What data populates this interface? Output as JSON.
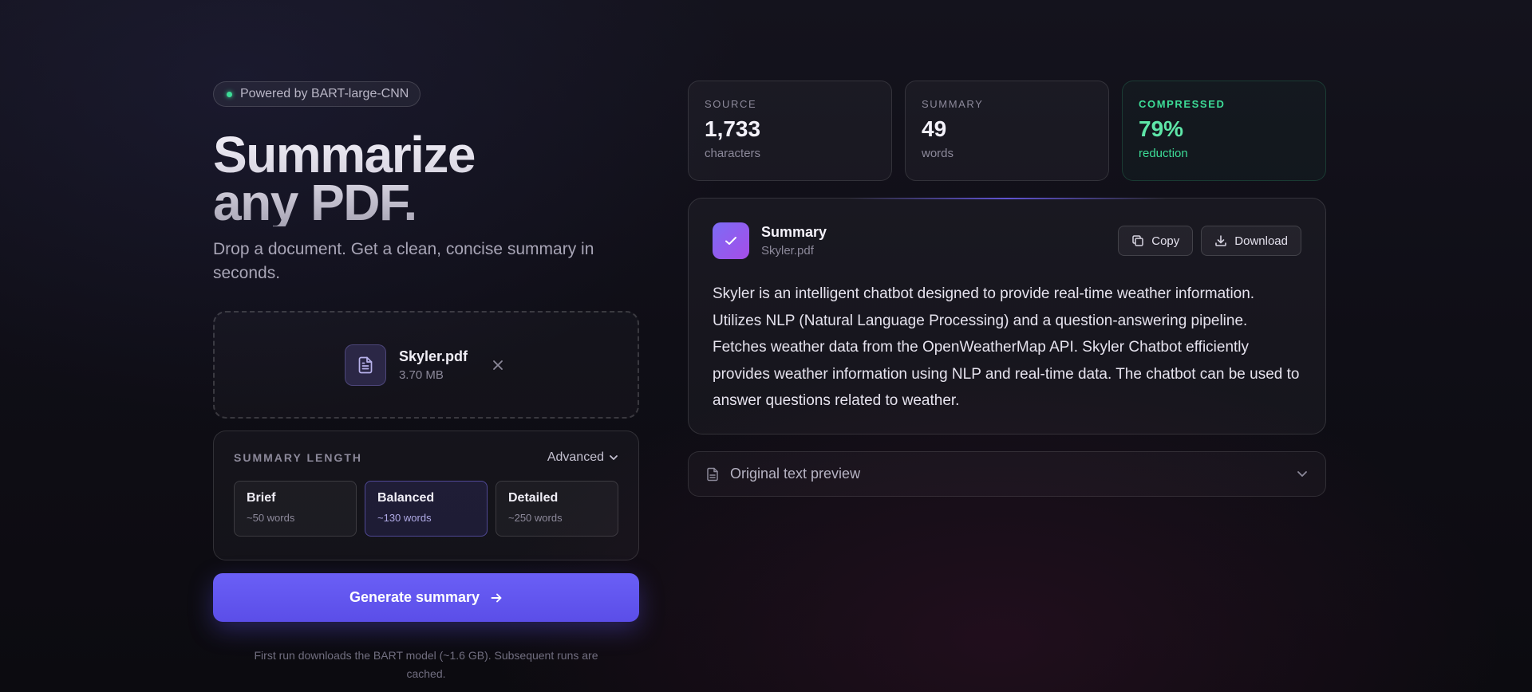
{
  "badge": {
    "text": "Powered by BART-large-CNN"
  },
  "hero": {
    "title_line1": "Summarize",
    "title_line2": "any PDF.",
    "subtitle": "Drop a document. Get a clean, concise summary in seconds."
  },
  "upload": {
    "file_name": "Skyler.pdf",
    "file_size": "3.70 MB",
    "icons": {
      "file": "file-text-icon",
      "remove": "close-icon"
    }
  },
  "length": {
    "label": "SUMMARY LENGTH",
    "advanced_label": "Advanced",
    "selected": "Balanced",
    "options": [
      {
        "title": "Brief",
        "sub": "~50 words"
      },
      {
        "title": "Balanced",
        "sub": "~130 words"
      },
      {
        "title": "Detailed",
        "sub": "~250 words"
      }
    ]
  },
  "generate": {
    "label": "Generate summary"
  },
  "footnote": "First run downloads the BART model (~1.6 GB). Subsequent runs are cached.",
  "stats": [
    {
      "label": "SOURCE",
      "value": "1,733",
      "unit": "characters"
    },
    {
      "label": "SUMMARY",
      "value": "49",
      "unit": "words"
    },
    {
      "label": "COMPRESSED",
      "value": "79%",
      "unit": "reduction"
    }
  ],
  "summary": {
    "title": "Summary",
    "file": "Skyler.pdf",
    "copy_label": "Copy",
    "download_label": "Download",
    "text": "Skyler is an intelligent chatbot designed to provide real-time weather information. Utilizes NLP (Natural Language Processing) and a question-answering pipeline. Fetches weather data from the OpenWeatherMap API. Skyler Chatbot efficiently provides weather information using NLP and real-time data. The chatbot can be used to answer questions related to weather."
  },
  "preview": {
    "label": "Original text preview"
  },
  "colors": {
    "accent": "#6a5ff6",
    "success": "#3ddc97",
    "background": "#0f0e16"
  }
}
